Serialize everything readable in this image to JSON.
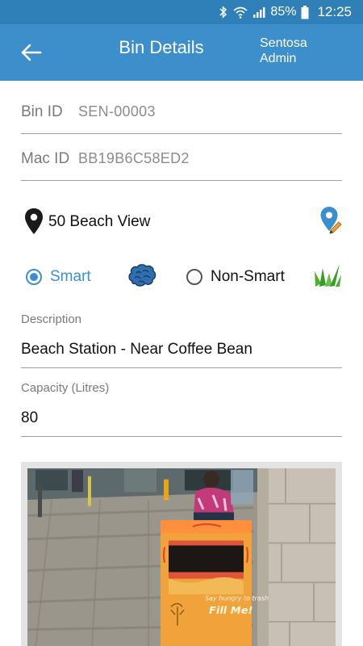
{
  "status": {
    "battery": "85%",
    "time": "12:25"
  },
  "header": {
    "title": "Bin Details",
    "user": "Sentosa Admin"
  },
  "fields": {
    "bin_id_label": "Bin ID",
    "bin_id_value": "SEN-00003",
    "mac_id_label": "Mac ID",
    "mac_id_value": "BB19B6C58ED2"
  },
  "location": {
    "text": "50 Beach View"
  },
  "bin_type": {
    "options": [
      "Smart",
      "Non-Smart"
    ],
    "selected": "Smart"
  },
  "description": {
    "label": "Description",
    "value": "Beach Station - Near Coffee Bean"
  },
  "capacity": {
    "label": "Capacity (Litres)",
    "value": "80"
  },
  "photo": {
    "bin_text_1": "Fill Me!"
  },
  "colors": {
    "primary": "#3d8fcb",
    "status_bar": "#2f7fb8",
    "bin_orange": "#f2a23a"
  }
}
